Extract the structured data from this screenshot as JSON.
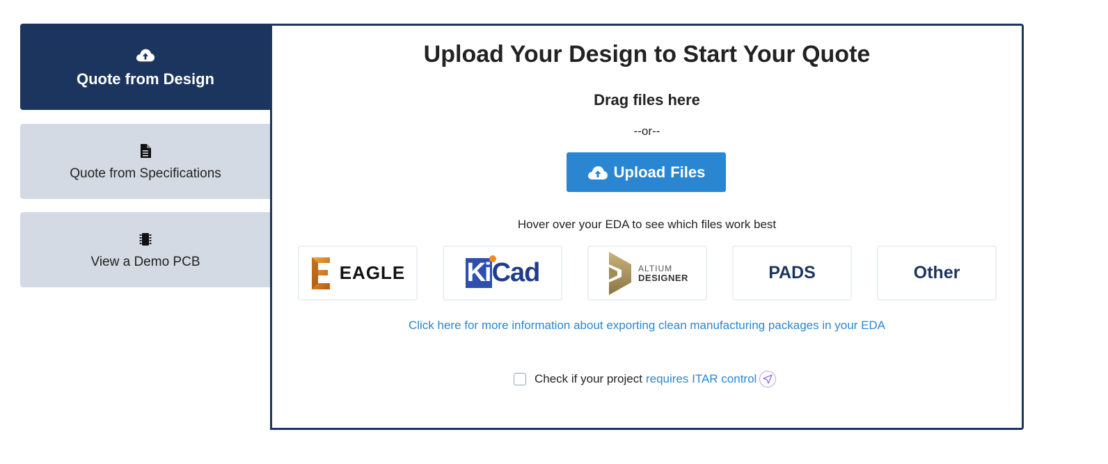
{
  "sidebar": {
    "tabs": [
      {
        "label": "Quote from Design",
        "icon": "cloud-upload-icon",
        "active": true
      },
      {
        "label": "Quote from Specifications",
        "icon": "document-icon",
        "active": false
      },
      {
        "label": "View a Demo PCB",
        "icon": "chip-icon",
        "active": false
      }
    ]
  },
  "main": {
    "title": "Upload Your Design to Start Your Quote",
    "drag_text": "Drag files here",
    "or_text": "--or--",
    "upload_button": {
      "word1": "Upload",
      "word2": "Files",
      "icon": "cloud-upload-icon"
    },
    "hover_text": "Hover over your EDA to see which files work best",
    "eda_tools": {
      "eagle": "EAGLE",
      "kicad_k": "Ki",
      "kicad_rest": "Cad",
      "altium_top": "ALTIUM",
      "altium_bottom": "DESIGNER",
      "pads": "PADS",
      "other": "Other"
    },
    "info_link": "Click here for more information about exporting clean manufacturing packages in your EDA",
    "itar": {
      "checked": false,
      "prefix": "Check if your project",
      "link": "requires ITAR control",
      "badge_icon": "navigation-arrow-icon"
    }
  },
  "colors": {
    "navy": "#1c355e",
    "tab_inactive_bg": "#d3dae3",
    "button_blue": "#2a86d0",
    "link_blue": "#2a86d0"
  }
}
